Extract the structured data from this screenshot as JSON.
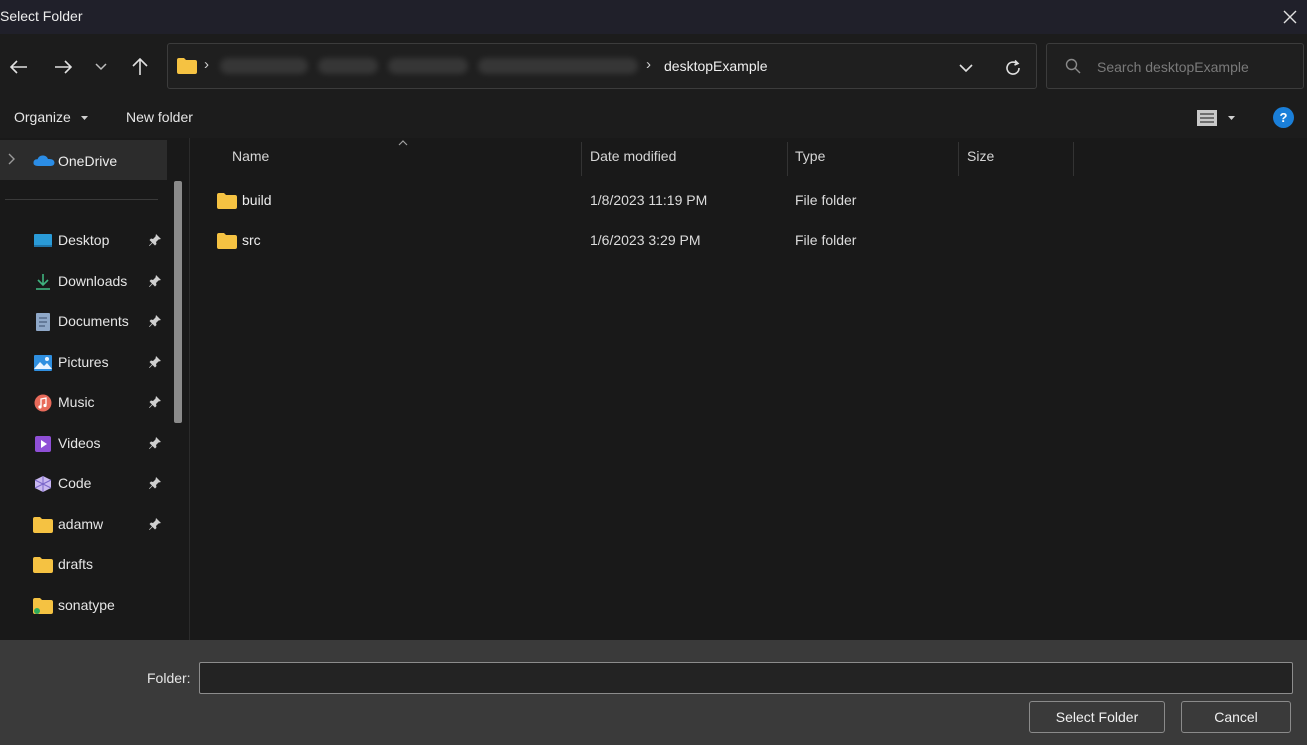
{
  "window": {
    "title": "Select Folder"
  },
  "nav": {
    "breadcrumb_current": "desktopExample",
    "search_placeholder": "Search desktopExample"
  },
  "commands": {
    "organize": "Organize",
    "new_folder": "New folder"
  },
  "sidebar": {
    "onedrive": "OneDrive",
    "items": [
      {
        "label": "Desktop",
        "icon": "desktop-icon",
        "pinned": true
      },
      {
        "label": "Downloads",
        "icon": "downloads-icon",
        "pinned": true
      },
      {
        "label": "Documents",
        "icon": "documents-icon",
        "pinned": true
      },
      {
        "label": "Pictures",
        "icon": "pictures-icon",
        "pinned": true
      },
      {
        "label": "Music",
        "icon": "music-icon",
        "pinned": true
      },
      {
        "label": "Videos",
        "icon": "videos-icon",
        "pinned": true
      },
      {
        "label": "Code",
        "icon": "code-icon",
        "pinned": true
      },
      {
        "label": "adamw",
        "icon": "folder-icon",
        "pinned": true
      },
      {
        "label": "drafts",
        "icon": "folder-icon",
        "pinned": false
      },
      {
        "label": "sonatype",
        "icon": "folder-icon",
        "pinned": false
      }
    ]
  },
  "columns": {
    "name": "Name",
    "date": "Date modified",
    "type": "Type",
    "size": "Size"
  },
  "files": [
    {
      "name": "build",
      "date": "1/8/2023 11:19 PM",
      "type": "File folder"
    },
    {
      "name": "src",
      "date": "1/6/2023 3:29 PM",
      "type": "File folder"
    }
  ],
  "footer": {
    "folder_label": "Folder:",
    "folder_value": "",
    "select_label": "Select Folder",
    "cancel_label": "Cancel"
  },
  "colors": {
    "accent": "#1a7fd9",
    "folder": "#f5c242",
    "background": "#191919",
    "footer": "#3a3a3a"
  }
}
